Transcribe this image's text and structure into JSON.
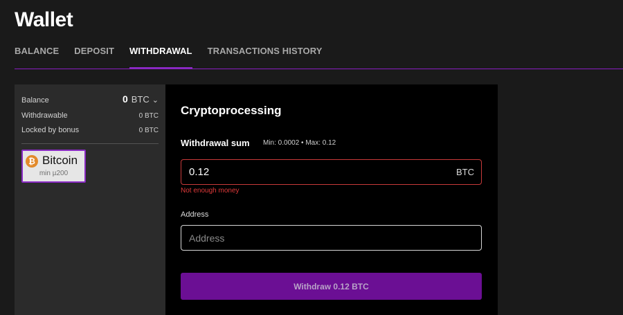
{
  "header": {
    "title": "Wallet"
  },
  "tabs": [
    {
      "label": "BALANCE",
      "active": false
    },
    {
      "label": "DEPOSIT",
      "active": false
    },
    {
      "label": "WITHDRAWAL",
      "active": true
    },
    {
      "label": "TRANSACTIONS HISTORY",
      "active": false
    }
  ],
  "balance": {
    "balance_label": "Balance",
    "balance_amount": "0",
    "balance_currency": "BTC",
    "withdrawable_label": "Withdrawable",
    "withdrawable_value": "0 BTC",
    "locked_label": "Locked by bonus",
    "locked_value": "0 BTC"
  },
  "method": {
    "name": "Bitcoin",
    "min": "min µ200",
    "icon": "bitcoin-icon",
    "symbol": "₿"
  },
  "form": {
    "title": "Cryptoprocessing",
    "sum_label": "Withdrawal sum",
    "sum_limits": "Min: 0.0002 • Max: 0.12",
    "amount_value": "0.12",
    "amount_currency": "BTC",
    "error": "Not enough money",
    "address_label": "Address",
    "address_placeholder": "Address",
    "submit_label": "Withdraw 0.12 BTC"
  },
  "colors": {
    "accent": "#8a2bc4",
    "button": "#6b0f94",
    "error": "#e03a3a",
    "bitcoin": "#e28a2a"
  }
}
